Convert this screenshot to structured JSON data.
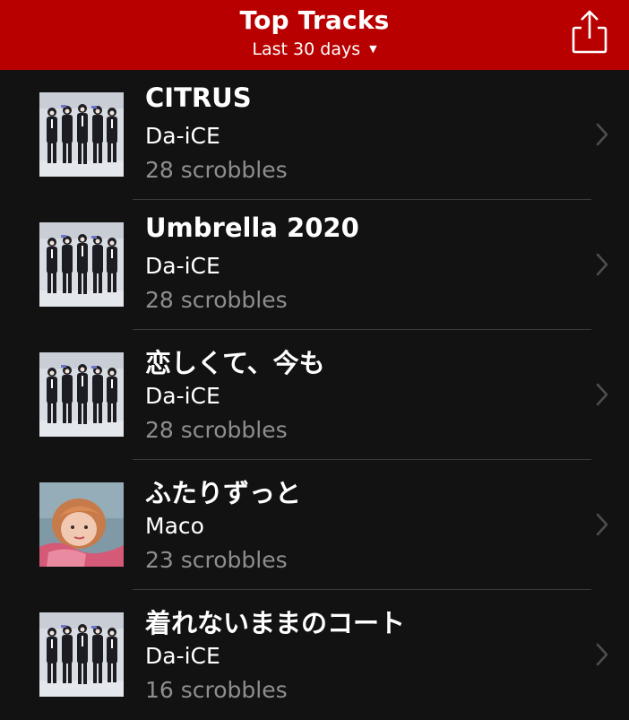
{
  "header": {
    "title": "Top Tracks",
    "period": "Last 30 days",
    "share_icon": "share-icon",
    "accent_color": "#b90000"
  },
  "tracks": [
    {
      "title": "CITRUS",
      "artist": "Da-iCE",
      "scrobbles": "28 scrobbles",
      "art": "group-photo"
    },
    {
      "title": "Umbrella 2020",
      "artist": "Da-iCE",
      "scrobbles": "28 scrobbles",
      "art": "group-photo"
    },
    {
      "title": "恋しくて、今も",
      "artist": "Da-iCE",
      "scrobbles": "28 scrobbles",
      "art": "group-photo"
    },
    {
      "title": "ふたりずっと",
      "artist": "Maco",
      "scrobbles": "23 scrobbles",
      "art": "portrait-photo"
    },
    {
      "title": "着れないままのコート",
      "artist": "Da-iCE",
      "scrobbles": "16 scrobbles",
      "art": "group-photo"
    }
  ]
}
